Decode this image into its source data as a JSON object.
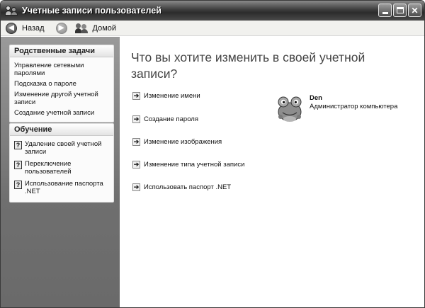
{
  "window": {
    "title": "Учетные записи пользователей",
    "controls": {
      "minimize": "_",
      "maximize": "□",
      "close": "✕"
    }
  },
  "toolbar": {
    "back_label": "Назад",
    "home_label": "Домой"
  },
  "sidebar": {
    "related_tasks": {
      "title": "Родственные задачи",
      "items": [
        "Управление сетевыми паролями",
        "Подсказка о пароле",
        "Изменение другой учетной записи",
        "Создание учетной записи"
      ]
    },
    "learn": {
      "title": "Обучение",
      "items": [
        "Удаление своей учетной записи",
        "Переключение пользователей",
        "Использование паспорта .NET"
      ]
    }
  },
  "main": {
    "heading": "Что вы хотите изменить в своей учетной записи?",
    "actions": [
      "Изменение имени",
      "Создание пароля",
      "Изменение изображения",
      "Изменение типа учетной записи",
      "Использовать паспорт .NET"
    ],
    "user": {
      "name": "Den",
      "role": "Администратор компьютера"
    }
  },
  "icons": {
    "title": "users-icon",
    "back": "back-arrow-icon",
    "forward": "forward-arrow-icon",
    "home": "users-home-icon",
    "help": "help-icon",
    "action": "arrow-right-icon",
    "avatar": "frog-avatar"
  }
}
